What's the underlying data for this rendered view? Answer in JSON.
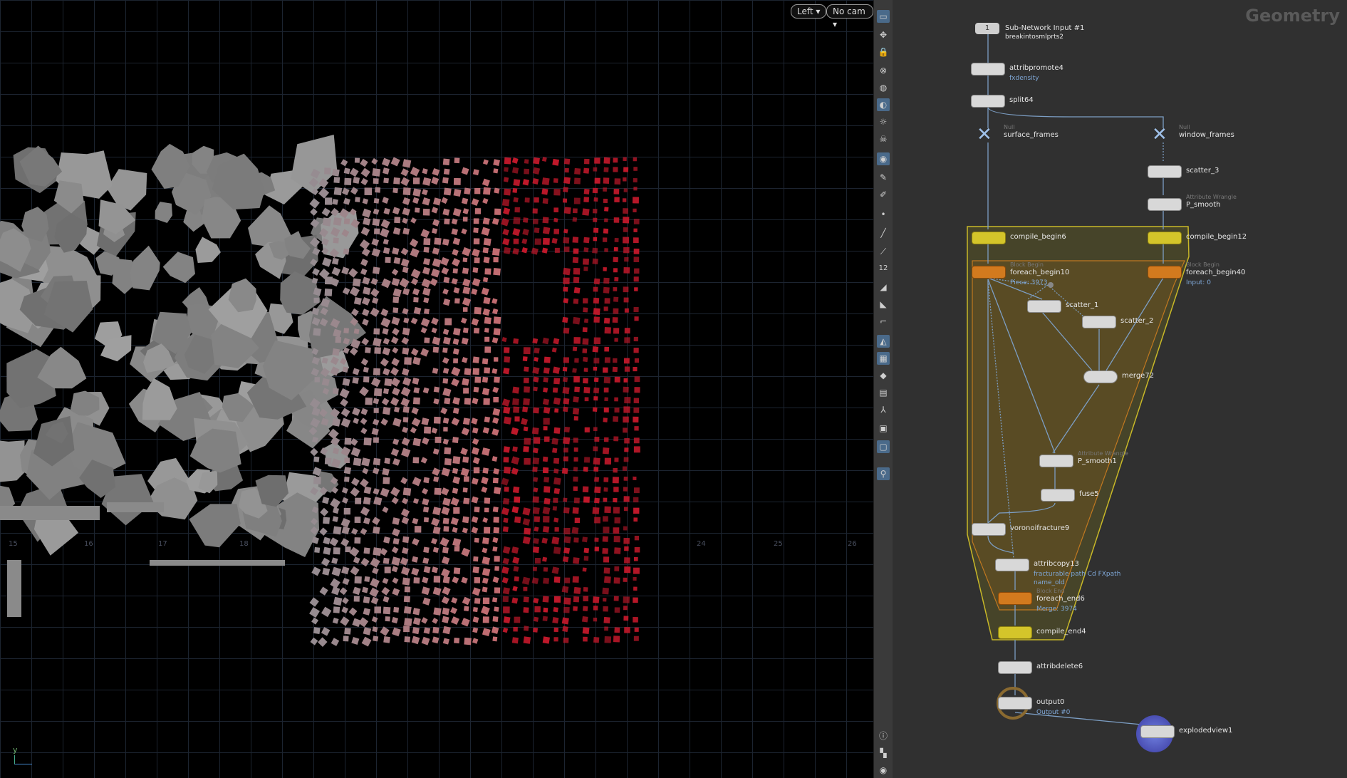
{
  "viewport": {
    "view_button": "Left ▾",
    "camera_button": "No cam ▾",
    "axis_y": "y",
    "ruler_labels": [
      "15",
      "16",
      "17",
      "18",
      "24",
      "25",
      "26"
    ]
  },
  "toolbar": {
    "icons": [
      "select-icon",
      "transform-icon",
      "lock-icon",
      "snap-icon",
      "ghost-icon",
      "light-icon",
      "bulb-icon",
      "skull-icon",
      "camera-icon",
      "pen-icon",
      "brush-icon",
      "point-icon",
      "edge-icon",
      "knife-icon",
      "number-icon",
      "shelf-icon",
      "shape-icon",
      "measure-icon",
      "tool-icon",
      "pattern-icon",
      "cube-icon",
      "map-icon",
      "join-icon",
      "box-icon",
      "display-icon",
      "pin-icon",
      "info-icon",
      "layout-icon",
      "eye-icon"
    ],
    "number_label": "12"
  },
  "network": {
    "title": "Geometry",
    "nodes": {
      "subnet_input": {
        "num": "1",
        "label": "Sub-Network Input #1",
        "sub": "breakintosmlprts2"
      },
      "attribpromote4": {
        "label": "attribpromote4",
        "sub": "fxdensity"
      },
      "split64": {
        "label": "split64"
      },
      "surface_frames": {
        "type": "Null",
        "label": "surface_frames"
      },
      "window_frames": {
        "type": "Null",
        "label": "window_frames"
      },
      "scatter_3": {
        "label": "scatter_3"
      },
      "p_smooth": {
        "type": "Attribute Wrangle",
        "label": "P_smooth"
      },
      "compile_begin6": {
        "label": "compile_begin6"
      },
      "compile_begin12": {
        "label": "compile_begin12"
      },
      "foreach_begin10": {
        "type": "Block Begin",
        "label": "foreach_begin10",
        "sub": "Piece: 3973"
      },
      "foreach_begin40": {
        "type": "Block Begin",
        "label": "foreach_begin40",
        "sub": "Input: 0"
      },
      "scatter_1": {
        "label": "scatter_1"
      },
      "scatter_2": {
        "label": "scatter_2"
      },
      "merge72": {
        "label": "merge72"
      },
      "p_smooth1": {
        "type": "Attribute Wrangle",
        "label": "P_smooth1"
      },
      "fuse5": {
        "label": "fuse5"
      },
      "voronoifracture9": {
        "label": "voronoifracture9"
      },
      "attribcopy13": {
        "label": "attribcopy13",
        "sub": "fracturable path Cd FXpath",
        "sub2": "name_old"
      },
      "foreach_end6": {
        "type": "Block End",
        "label": "foreach_end6",
        "sub": "Merge: 3974"
      },
      "compile_end4": {
        "label": "compile_end4"
      },
      "attribdelete6": {
        "label": "attribdelete6"
      },
      "output0": {
        "label": "output0",
        "sub": "Output #0"
      },
      "explodedview1": {
        "label": "explodedview1"
      }
    }
  },
  "colors": {
    "accent_blue": "#7fa7d6",
    "yellow_node": "#d4c52a",
    "orange_node": "#d27a1e",
    "fracture_red": "#c0182a"
  }
}
